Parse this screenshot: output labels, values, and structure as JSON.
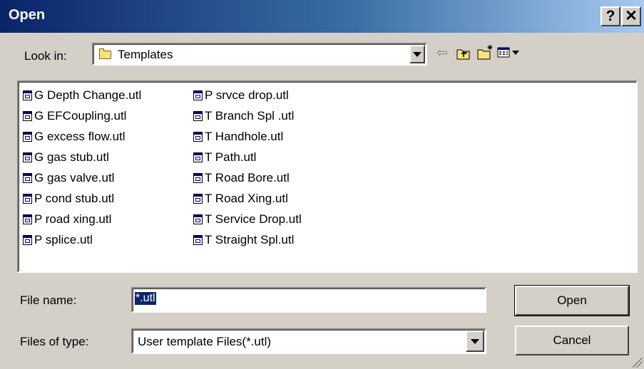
{
  "window": {
    "title": "Open",
    "help_button": "?",
    "close_button": "✕"
  },
  "look_in": {
    "label": "Look in:",
    "value": "Templates",
    "icon": "folder-icon"
  },
  "toolbar": {
    "back_icon": "⇦",
    "up_folder_icon": "up-folder-icon",
    "new_folder_icon": "new-folder-icon",
    "view_menu_icon": "view-menu-icon"
  },
  "files": {
    "column1": [
      "G Depth Change.utl",
      "G EFCoupling.utl",
      "G excess flow.utl",
      "G gas stub.utl",
      "G gas valve.utl",
      "P cond stub.utl",
      "P road xing.utl",
      "P splice.utl"
    ],
    "column2": [
      "P srvce drop.utl",
      "T Branch Spl .utl",
      "T Handhole.utl",
      "T Path.utl",
      "T Road Bore.utl",
      "T Road Xing.utl",
      "T Service Drop.utl",
      "T Straight Spl.utl"
    ]
  },
  "file_name": {
    "label": "File name:",
    "value": "*.utl"
  },
  "file_type": {
    "label": "Files of type:",
    "value": "User template Files(*.utl)"
  },
  "buttons": {
    "open": "Open",
    "cancel": "Cancel"
  },
  "colors": {
    "titlebar_start": "#0a246a",
    "titlebar_end": "#a6caf0",
    "face": "#d4d0c8",
    "selection": "#0a246a"
  }
}
